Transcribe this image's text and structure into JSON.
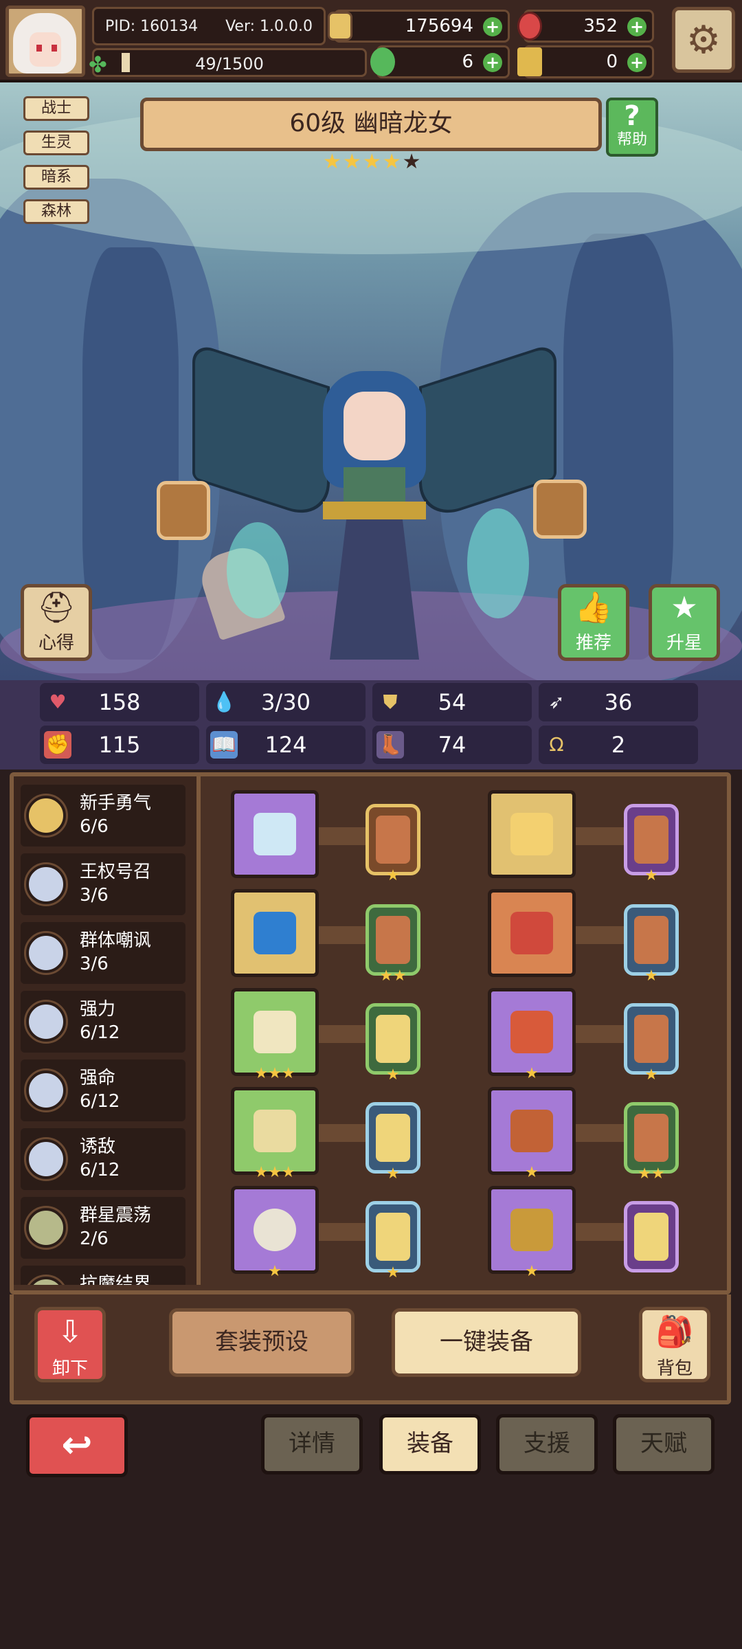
{
  "top": {
    "pid": "PID: 160134",
    "version": "Ver: 1.0.0.0",
    "exp": "49/1500",
    "exp_fraction": 0.033,
    "gold": "175694",
    "gems": "352",
    "clover": "6",
    "key": "0"
  },
  "hero": {
    "tags": [
      "战士",
      "生灵",
      "暗系",
      "森林"
    ],
    "title": "60级 幽暗龙女",
    "stars_filled": 4,
    "stars_total": 5,
    "help_label": "帮助",
    "notes_label": "心得",
    "recommend_label": "推荐",
    "upgrade_label": "升星"
  },
  "stats": [
    {
      "icon": "heart-icon",
      "value": "158"
    },
    {
      "icon": "drop-icon",
      "value": "3/30"
    },
    {
      "icon": "shield-icon",
      "value": "54"
    },
    {
      "icon": "wing-icon",
      "value": "36"
    },
    {
      "icon": "fist-icon",
      "value": "115"
    },
    {
      "icon": "book-icon",
      "value": "124"
    },
    {
      "icon": "boot-icon",
      "value": "74"
    },
    {
      "icon": "horseshoe-icon",
      "value": "2"
    }
  ],
  "sets": [
    {
      "name": "新手勇气",
      "count": "6/6",
      "color": "#e6c267"
    },
    {
      "name": "王权号召",
      "count": "3/6",
      "color": "#c9d3e8"
    },
    {
      "name": "群体嘲讽",
      "count": "3/6",
      "color": "#c9d3e8"
    },
    {
      "name": "强力",
      "count": "6/12",
      "color": "#c9d3e8"
    },
    {
      "name": "强命",
      "count": "6/12",
      "color": "#c9d3e8"
    },
    {
      "name": "诱敌",
      "count": "6/12",
      "color": "#c9d3e8"
    },
    {
      "name": "群星震荡",
      "count": "2/6",
      "color": "#b6b98a"
    },
    {
      "name": "抗魔结界",
      "count": "",
      "color": "#b6b98a"
    }
  ],
  "actions": {
    "unequip": "卸下",
    "preset": "套装预设",
    "auto_equip": "一键装备",
    "backpack": "背包"
  },
  "tabs": [
    "详情",
    "装备",
    "支援",
    "天赋"
  ],
  "active_tab": "装备"
}
